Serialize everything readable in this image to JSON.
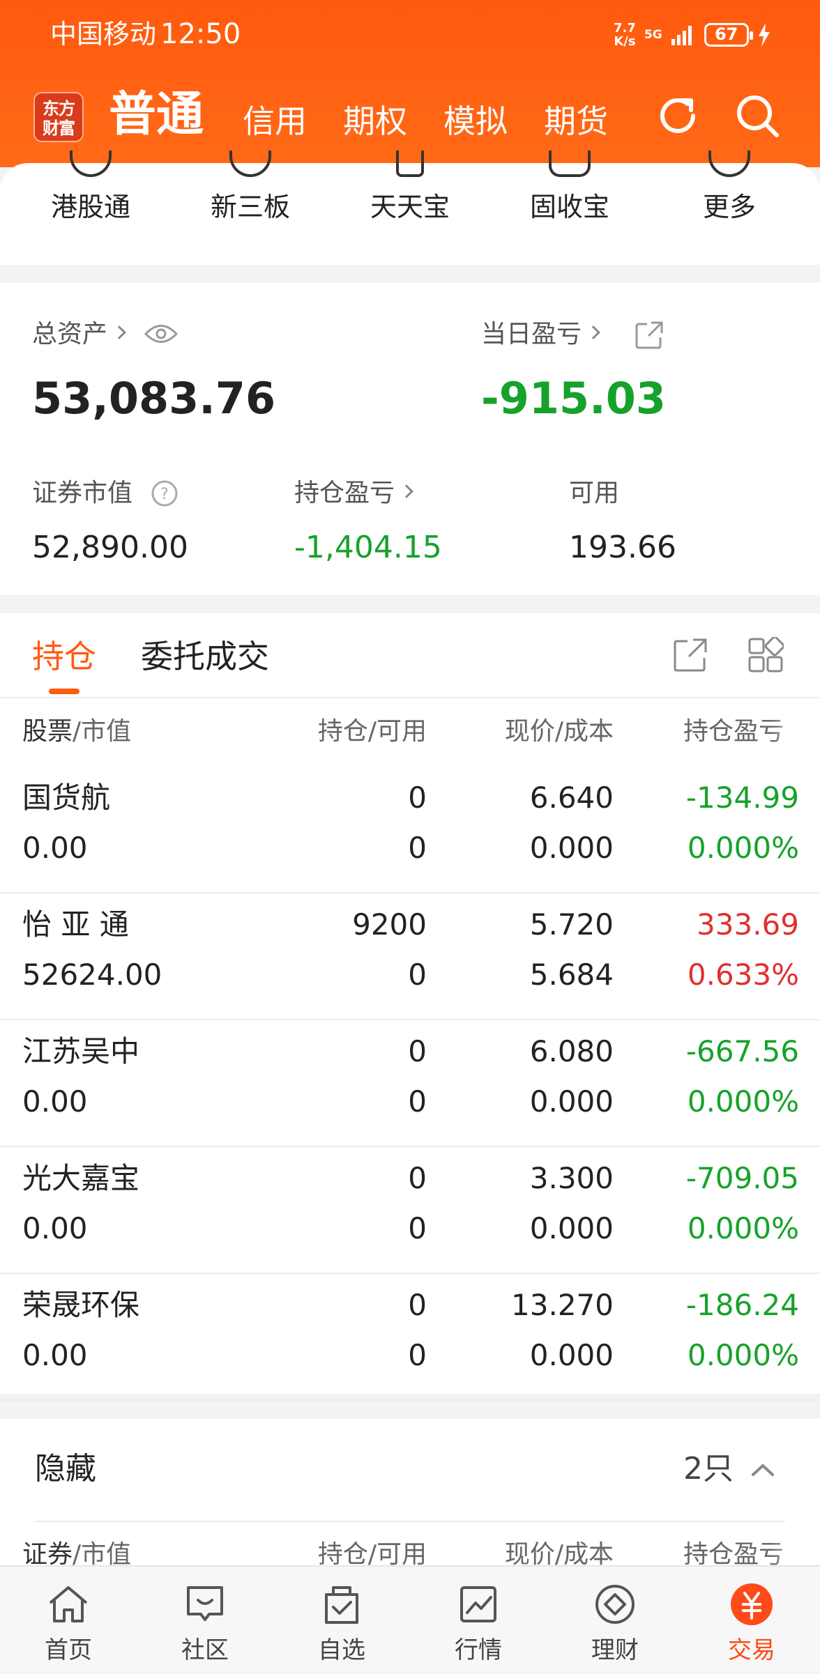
{
  "status_bar": {
    "carrier": "中国移动",
    "time": "12:50",
    "net_speed_value": "7.7",
    "net_speed_unit": "K/s",
    "network": "5G",
    "battery": "67"
  },
  "header": {
    "logo_line1": "东方",
    "logo_line2": "财富",
    "tabs": [
      {
        "label": "普通",
        "active": true
      },
      {
        "label": "信用"
      },
      {
        "label": "期权"
      },
      {
        "label": "模拟"
      },
      {
        "label": "期货"
      }
    ],
    "icons": [
      "refresh-icon",
      "search-icon"
    ]
  },
  "quick_links": [
    {
      "label": "港股通"
    },
    {
      "label": "新三板"
    },
    {
      "label": "天天宝"
    },
    {
      "label": "固收宝"
    },
    {
      "label": "更多"
    }
  ],
  "assets": {
    "total_label": "总资产",
    "total_value": "53,083.76",
    "daily_pnl_label": "当日盈亏",
    "daily_pnl_value": "-915.03",
    "market_value_label": "证券市值",
    "market_value": "52,890.00",
    "position_pnl_label": "持仓盈亏",
    "position_pnl_value": "-1,404.15",
    "available_label": "可用",
    "available_value": "193.66"
  },
  "holdings_tabs": {
    "active": "持仓",
    "other": "委托成交"
  },
  "table_headers": {
    "stock": "股票",
    "stock_sub": "/市值",
    "qty": "持仓/可用",
    "price": "现价/成本",
    "pnl": "持仓盈亏"
  },
  "rows": [
    {
      "name": "国货航",
      "market_value": "0.00",
      "qty": "0",
      "avail": "0",
      "price": "6.640",
      "cost": "0.000",
      "pnl": "-134.99",
      "pnl_pct": "0.000%",
      "trend": "down"
    },
    {
      "name": "怡 亚 通",
      "market_value": "52624.00",
      "qty": "9200",
      "avail": "0",
      "price": "5.720",
      "cost": "5.684",
      "pnl": "333.69",
      "pnl_pct": "0.633%",
      "trend": "up"
    },
    {
      "name": "江苏吴中",
      "market_value": "0.00",
      "qty": "0",
      "avail": "0",
      "price": "6.080",
      "cost": "0.000",
      "pnl": "-667.56",
      "pnl_pct": "0.000%",
      "trend": "down"
    },
    {
      "name": "光大嘉宝",
      "market_value": "0.00",
      "qty": "0",
      "avail": "0",
      "price": "3.300",
      "cost": "0.000",
      "pnl": "-709.05",
      "pnl_pct": "0.000%",
      "trend": "down"
    },
    {
      "name": "荣晟环保",
      "market_value": "0.00",
      "qty": "0",
      "avail": "0",
      "price": "13.270",
      "cost": "0.000",
      "pnl": "-186.24",
      "pnl_pct": "0.000%",
      "trend": "down"
    }
  ],
  "hidden": {
    "label": "隐藏",
    "count": "2只",
    "col_stock": "证券",
    "col_stock_sub": "/市值",
    "col_qty": "持仓/可用",
    "col_price": "现价/成本",
    "col_pnl": "持仓盈亏"
  },
  "bottom_nav": [
    {
      "label": "首页",
      "icon": "home-icon"
    },
    {
      "label": "社区",
      "icon": "chat-icon"
    },
    {
      "label": "自选",
      "icon": "watchlist-icon"
    },
    {
      "label": "行情",
      "icon": "chart-icon"
    },
    {
      "label": "理财",
      "icon": "finance-icon"
    },
    {
      "label": "交易",
      "icon": "yuan-icon",
      "active": true
    }
  ],
  "colors": {
    "brand": "#ff5a0e",
    "up": "#e0302f",
    "down": "#16a22a"
  }
}
